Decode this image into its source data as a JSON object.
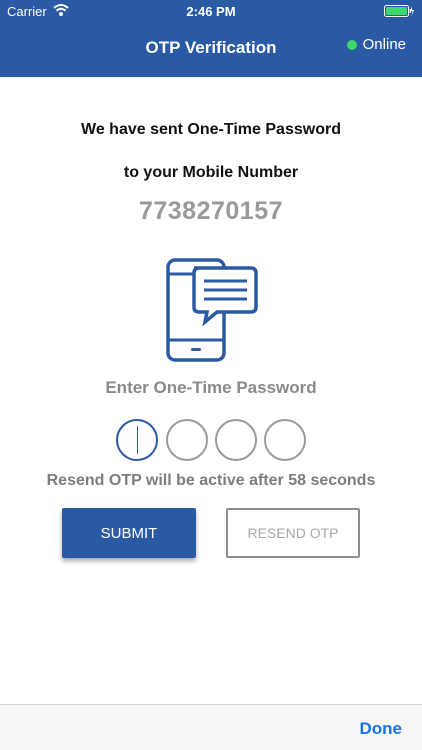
{
  "status_bar": {
    "carrier": "Carrier",
    "time": "2:46 PM"
  },
  "header": {
    "title": "OTP Verification",
    "status": "Online",
    "status_color": "#3fd96b"
  },
  "message": {
    "line1": "We have sent One-Time Password",
    "line2": "to your Mobile Number"
  },
  "mobile_number": "7738270157",
  "otp": {
    "label": "Enter One-Time Password",
    "digits": [
      "",
      "",
      "",
      ""
    ]
  },
  "resend_message": "Resend OTP will be active after 58 seconds",
  "buttons": {
    "submit": "SUBMIT",
    "resend": "RESEND OTP"
  },
  "toolbar": {
    "done": "Done"
  },
  "colors": {
    "primary": "#2b5aa5",
    "link": "#1a73e8"
  },
  "icons": [
    "wifi-icon",
    "battery-icon",
    "phone-chat-icon"
  ]
}
